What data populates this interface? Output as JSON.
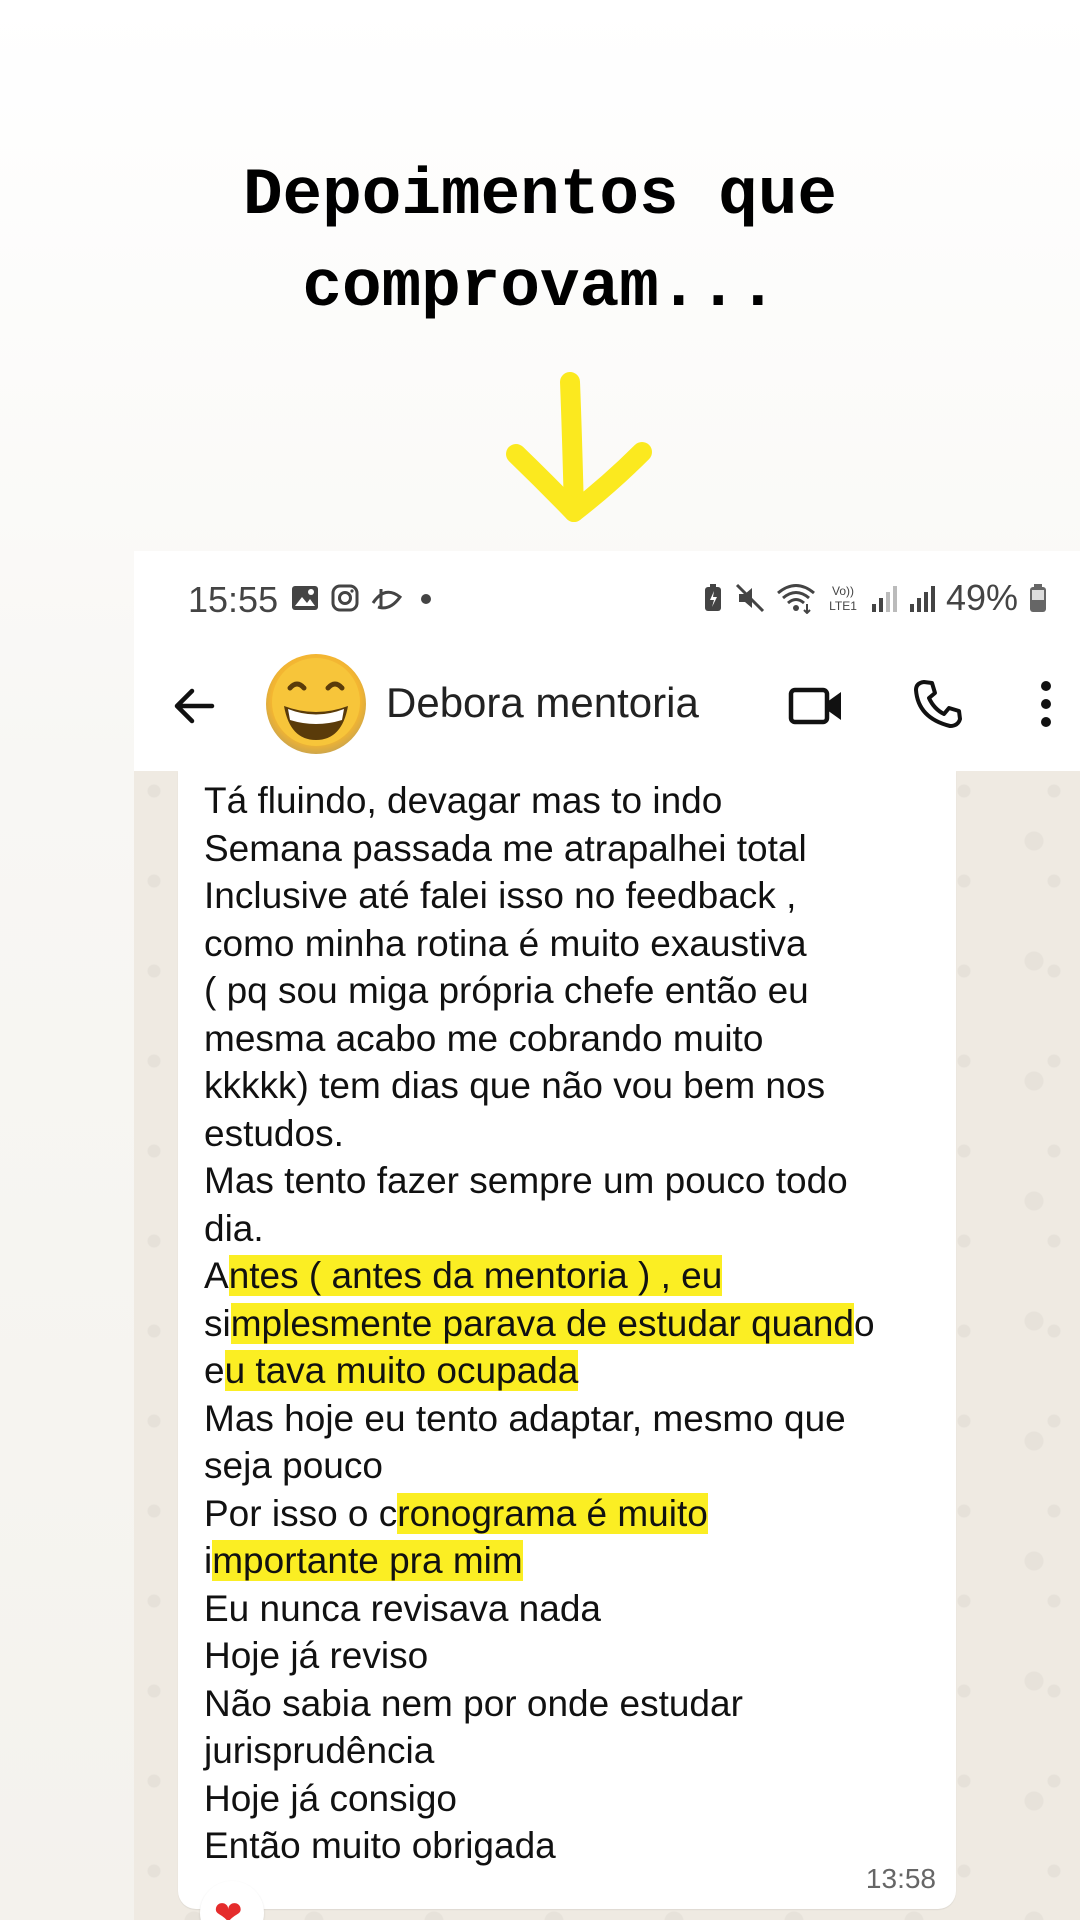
{
  "headline": {
    "line1": "Depoimentos que",
    "line2": "comprovam..."
  },
  "accent_color": "#fbee23",
  "arrow_icon": "arrow-down-icon",
  "statusbar": {
    "time": "15:55",
    "battery_percent": "49%",
    "left_icons": [
      "gallery-icon",
      "instagram-icon",
      "disney-plus-icon",
      "dot-icon"
    ],
    "right_icons": [
      "battery-saver-icon",
      "mute-icon",
      "wifi-icon",
      "volte-icon",
      "signal-icon",
      "signal-icon",
      "battery-icon"
    ],
    "volte_label": "Vo)) LTE1"
  },
  "appbar": {
    "contact_name": "Debora mentoria",
    "avatar_icon": "grinning-face-emoji"
  },
  "message": {
    "lines": [
      [
        {
          "t": "Tá fluindo, devagar mas to indo"
        }
      ],
      [
        {
          "t": "Semana passada me atrapalhei total"
        }
      ],
      [
        {
          "t": "Inclusive até falei isso no feedback ,"
        }
      ],
      [
        {
          "t": "como minha rotina é muito exaustiva"
        }
      ],
      [
        {
          "t": "( pq sou miga própria chefe então eu"
        }
      ],
      [
        {
          "t": "mesma acabo me cobrando muito"
        }
      ],
      [
        {
          "t": "kkkkk) tem dias que não vou bem nos"
        }
      ],
      [
        {
          "t": "estudos."
        }
      ],
      [
        {
          "t": "Mas tento fazer sempre um pouco todo"
        }
      ],
      [
        {
          "t": "dia."
        }
      ],
      [
        {
          "t": "A"
        },
        {
          "t": "ntes ( antes da mentoria ) , eu",
          "hl": true
        }
      ],
      [
        {
          "t": "si"
        },
        {
          "t": "mplesmente parava de estudar quand",
          "hl": true
        },
        {
          "t": "o"
        }
      ],
      [
        {
          "t": "e"
        },
        {
          "t": "u tava muito ocupada",
          "hl": true
        }
      ],
      [
        {
          "t": "Mas hoje eu tento adaptar, mesmo que"
        }
      ],
      [
        {
          "t": "seja pouco"
        }
      ],
      [
        {
          "t": "Por isso o c"
        },
        {
          "t": "ronograma é muito",
          "hl": true
        }
      ],
      [
        {
          "t": "i"
        },
        {
          "t": "mportante pra mim",
          "hl": true
        }
      ],
      [
        {
          "t": "Eu nunca revisava nada"
        }
      ],
      [
        {
          "t": "Hoje já reviso"
        }
      ],
      [
        {
          "t": "Não sabia nem por onde estudar"
        }
      ],
      [
        {
          "t": "jurisprudência"
        }
      ],
      [
        {
          "t": "Hoje já consigo"
        }
      ],
      [
        {
          "t": "Então muito obrigada"
        }
      ]
    ],
    "time": "13:58",
    "reaction": "❤"
  }
}
